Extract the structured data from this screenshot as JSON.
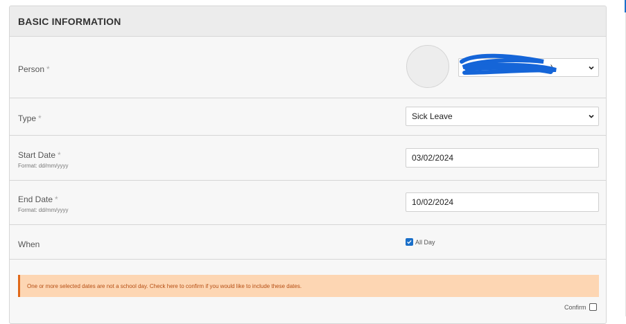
{
  "section": {
    "title": "BASIC INFORMATION"
  },
  "person": {
    "label": "Person",
    "required_mark": "*",
    "value": "…)"
  },
  "type": {
    "label": "Type",
    "required_mark": "*",
    "value": "Sick Leave"
  },
  "start_date": {
    "label": "Start Date",
    "required_mark": "*",
    "hint": "Format: dd/mm/yyyy",
    "value": "03/02/2024"
  },
  "end_date": {
    "label": "End Date",
    "required_mark": "*",
    "hint": "Format: dd/mm/yyyy",
    "value": "10/02/2024"
  },
  "when": {
    "label": "When",
    "all_day_label": "All Day",
    "all_day_checked": true
  },
  "alert": {
    "message": "One or more selected dates are not a school day. Check here to confirm if you would like to include these dates.",
    "color": "#fdd6b3"
  },
  "confirm": {
    "label": "Confirm",
    "checked": false
  },
  "icons": {
    "select_caret": "chevron-down-icon",
    "check": "checkmark-icon"
  },
  "colors": {
    "accent": "#1a6fc9",
    "alert_border": "#e06818",
    "alert_text": "#b54d12"
  }
}
